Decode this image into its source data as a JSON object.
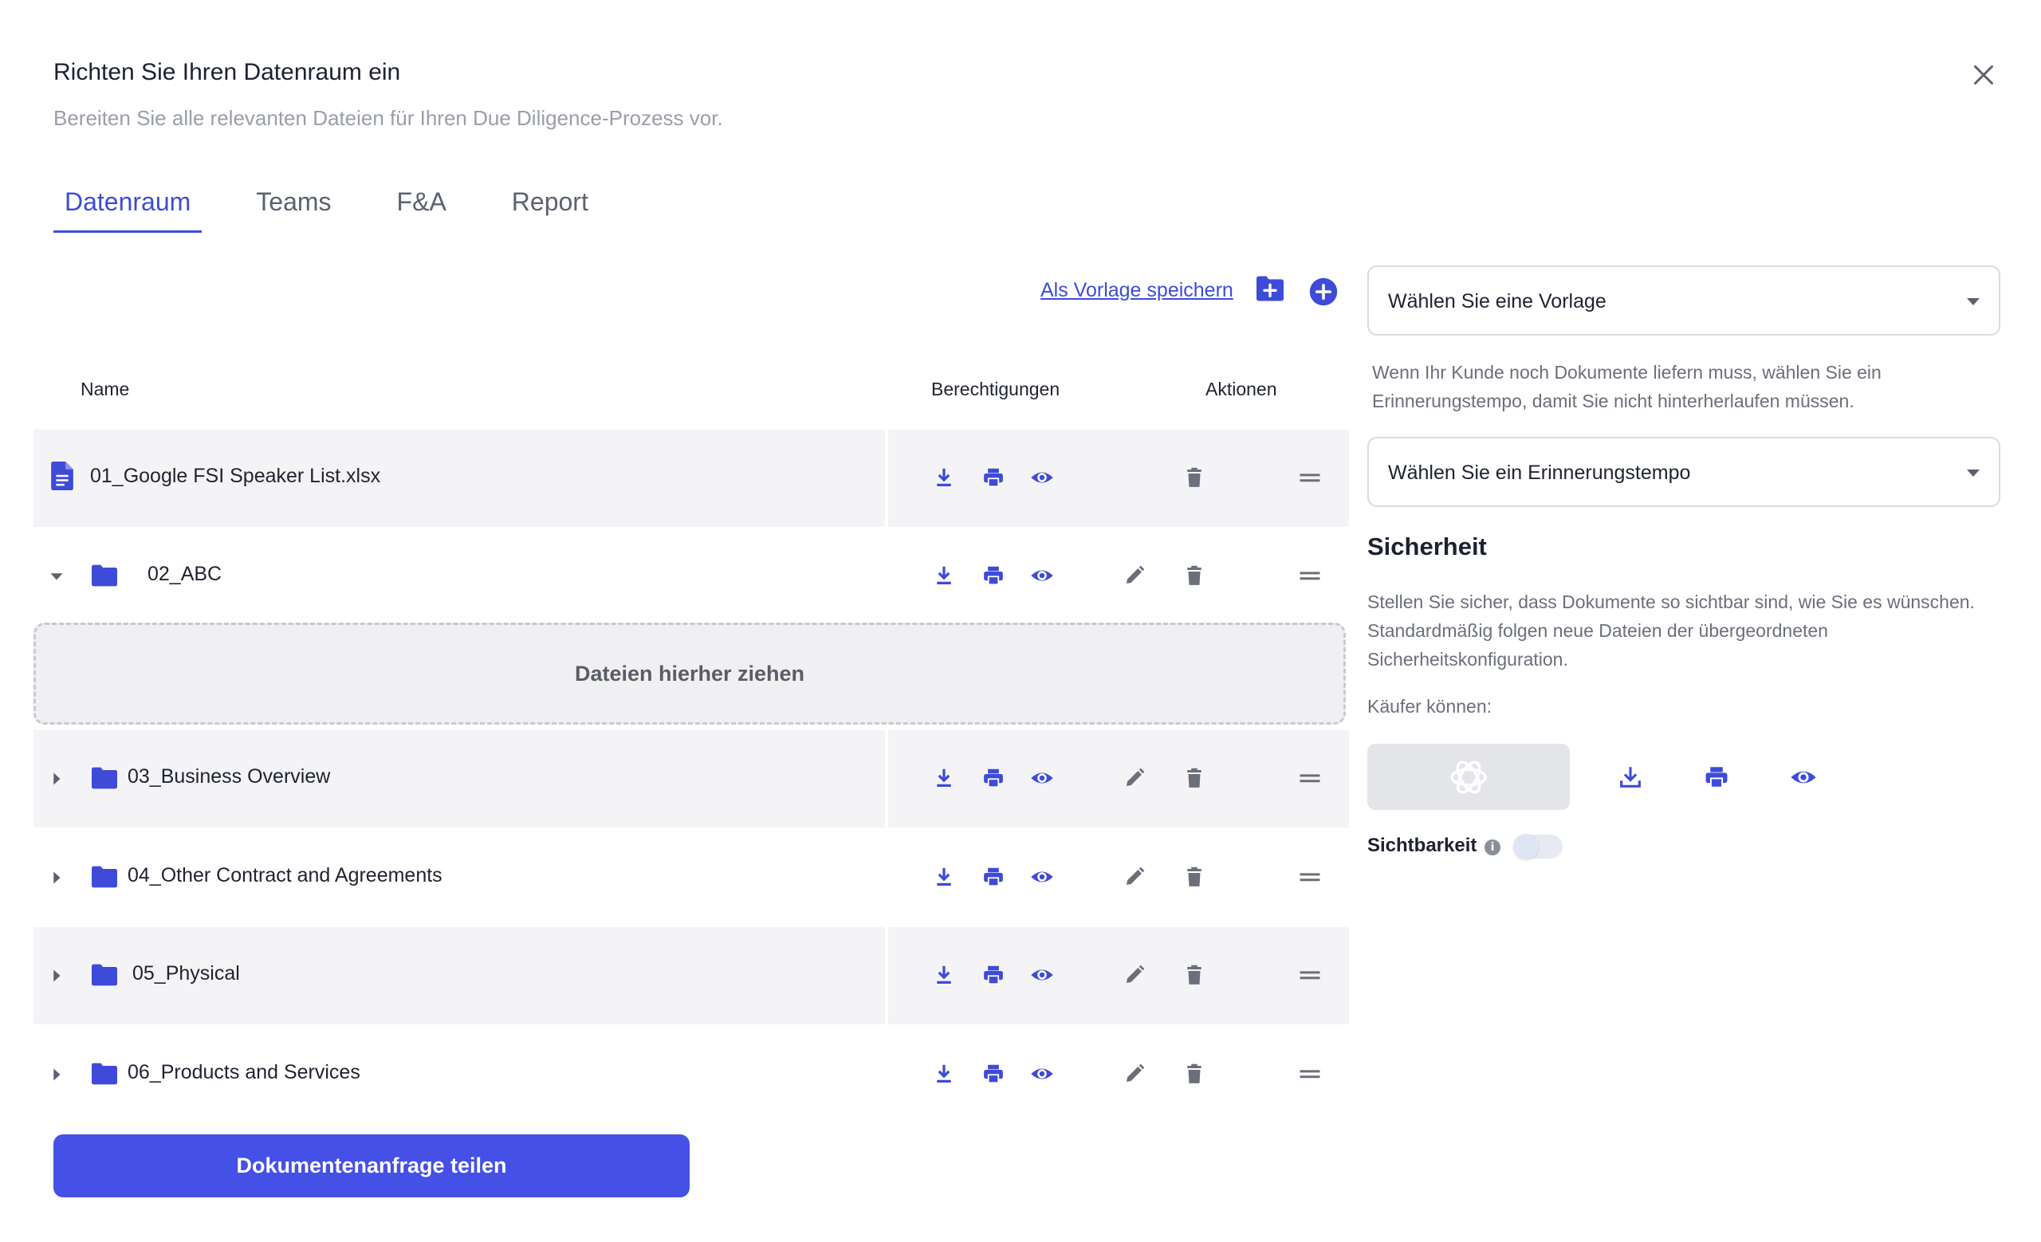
{
  "header": {
    "title": "Richten Sie Ihren Datenraum ein",
    "subtitle": "Bereiten Sie alle relevanten Dateien für Ihren Due Diligence-Prozess vor."
  },
  "tabs": [
    {
      "label": "Datenraum",
      "active": true
    },
    {
      "label": "Teams",
      "active": false
    },
    {
      "label": "F&A",
      "active": false
    },
    {
      "label": "Report",
      "active": false
    }
  ],
  "toolbar": {
    "save_template_label": "Als Vorlage speichern"
  },
  "table": {
    "columns": {
      "name": "Name",
      "permissions": "Berechtigungen",
      "actions": "Aktionen"
    },
    "rows": [
      {
        "name": "01_Google FSI Speaker List.xlsx",
        "type": "file"
      },
      {
        "name": "02_ABC",
        "type": "folder",
        "expanded": true
      },
      {
        "name": "03_Business Overview",
        "type": "folder",
        "expanded": false
      },
      {
        "name": "04_Other Contract and Agreements",
        "type": "folder",
        "expanded": false
      },
      {
        "name": "05_Physical",
        "type": "folder",
        "expanded": false
      },
      {
        "name": "06_Products and Services",
        "type": "folder",
        "expanded": false
      }
    ],
    "dropzone_label": "Dateien hierher ziehen"
  },
  "share_button_label": "Dokumentenanfrage teilen",
  "sidebar": {
    "template_select": {
      "value": "Wählen Sie eine Vorlage"
    },
    "reminder_note": "Wenn Ihr Kunde noch Dokumente liefern muss, wählen Sie ein Erinnerungstempo, damit Sie nicht hinterherlaufen müssen.",
    "reminder_select": {
      "value": "Wählen Sie ein Erinnerungstempo"
    },
    "security": {
      "title": "Sicherheit",
      "description": "Stellen Sie sicher, dass Dokumente so sichtbar sind, wie Sie es wünschen. Standardmäßig folgen neue Dateien der übergeordneten Sicherheitskonfiguration.",
      "buyers_label": "Käufer können:",
      "visibility_label": "Sichtbarkeit",
      "visibility_on": false
    }
  },
  "colors": {
    "accent": "#3e4bd9",
    "button": "#4550e6",
    "row_shade": "#f4f4f6",
    "icon_gray": "#6b6f7a"
  }
}
